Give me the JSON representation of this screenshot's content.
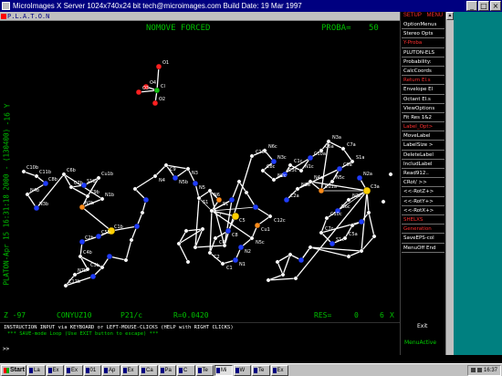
{
  "window": {
    "title": "MicroImages X Server  1024x740x24 bit  tech@microimages.com  Build Date: 19 Mar 1997",
    "buttons": {
      "minimize": "_",
      "maximize": "□",
      "close": "×"
    }
  },
  "platon_window": {
    "title": "P.L.A.T.O.N"
  },
  "canvas": {
    "mode": "NOMOVE FORCED",
    "proba_label": "PROBA=",
    "proba_value": "50",
    "side_label_top": "-16 Y",
    "side_label_main": "PLATON-Apr 15 16:31:18 2000 - (130400)",
    "status": {
      "z": "Z  -97",
      "name": "CONYUZ10",
      "space_group": "P21/c",
      "r_factor": "R=0.0420",
      "res": "RES=",
      "res_value": "0",
      "scale": "6",
      "axis": "X"
    }
  },
  "atom_labels": {
    "perchlorate": [
      "O1",
      "O4",
      "O3",
      "Cl",
      "O2"
    ],
    "left": [
      "C10b",
      "C11b",
      "C8b",
      "N4b",
      "N3b",
      "C6b",
      "C7b",
      "S1b",
      "Cu1b",
      "C9b",
      "N2b",
      "N1b",
      "C1b",
      "C5b",
      "C2b",
      "C4b",
      "C3b",
      "N7b",
      "C12b"
    ],
    "center": [
      "N4",
      "C9",
      "N5b",
      "N3",
      "N5",
      "S1",
      "N6",
      "S1",
      "C7",
      "C5",
      "C8",
      "C6",
      "C2",
      "C1",
      "N1",
      "N2",
      "N5c",
      "Cu1",
      "C12c"
    ],
    "right": [
      "C10c",
      "N6c",
      "N3c",
      "C8c",
      "N2c",
      "C3c",
      "C1c",
      "N1c",
      "C10a",
      "C6a",
      "N3a",
      "C7a",
      "S1a",
      "C9a",
      "N5c",
      "Cu1a",
      "N4a",
      "N1a",
      "C2a",
      "N2a",
      "C3a",
      "N3c",
      "N6c",
      "C10c",
      "C7c",
      "S1c",
      "C5a"
    ]
  },
  "console": {
    "line1": "INSTRUCTION INPUT via KEYBOARD or LEFT-MOUSE-CLICKS (HELP with RIGHT CLICKS)",
    "line2": "*** SAVE-mode Loop (Use EXIT button to escape) ***",
    "prompt": ">>"
  },
  "menu": {
    "head_left": "SETUP",
    "head_right": "MENU",
    "items": [
      {
        "label": "OptionMenus",
        "red": false
      },
      {
        "label": "Stereo Opts",
        "red": false
      },
      {
        "label": "Y-Proba",
        "red": true
      },
      {
        "label": "PLUTON-ELS",
        "red": false
      },
      {
        "label": "Probability:",
        "red": false
      },
      {
        "label": "CalcCoords",
        "red": false
      },
      {
        "label": "Return El.s",
        "red": true
      },
      {
        "label": "Envelope El",
        "red": false
      },
      {
        "label": "Octant El.s",
        "red": false
      },
      {
        "label": "ViewOptions",
        "red": false
      },
      {
        "label": "Fit Res 1&2",
        "red": false
      },
      {
        "label": "Label_Opt>",
        "red": true
      },
      {
        "label": "MoveLabel",
        "red": false
      },
      {
        "label": "LabelSize >",
        "red": false
      },
      {
        "label": "DeleteLabel",
        "red": false
      },
      {
        "label": "IncludLabel",
        "red": false
      },
      {
        "label": "Read912..",
        "red": false
      },
      {
        "label": "CRot/ >>",
        "red": false
      },
      {
        "label": "<<-RotZ+>",
        "red": false
      },
      {
        "label": "<<-RotY+>",
        "red": false
      },
      {
        "label": "<<-RotX+>",
        "red": false
      },
      {
        "label": "SHELXS",
        "red": true
      },
      {
        "label": "Generation",
        "red": true
      },
      {
        "label": "SaveEPS-col",
        "red": false
      },
      {
        "label": "MenuOff End",
        "red": false
      }
    ],
    "exit": "Exit",
    "active": "MenuActive"
  },
  "taskbar": {
    "start": "Start",
    "buttons": [
      "La",
      "Ex",
      "Ex",
      "01",
      "Ap",
      "Ex",
      "Ca",
      "Pa",
      "C",
      "Te",
      "Mi",
      "W",
      "Te",
      "Ex"
    ],
    "active_index": 10,
    "clock": "16:37"
  },
  "colors": {
    "title_bg": "#000080",
    "canvas_bg": "#000000",
    "label_green": "#00c000",
    "menu_red": "#ff3030",
    "bond": "#ffffff",
    "copper": "#ffd000",
    "nitrogen": "#1f3cff",
    "sulfur": "#ff8c1a",
    "oxygen": "#ff2020",
    "chlorine": "#10c010",
    "carbon": "#ffffff"
  }
}
